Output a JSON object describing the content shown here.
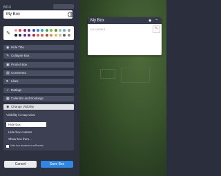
{
  "editor": {
    "section_label": "BOX",
    "name_value": "My Box",
    "menu": [
      {
        "label": "Hide Title",
        "icon": "eye-slash-icon",
        "glyph": "◉"
      },
      {
        "label": "Collapse Box",
        "icon": "wrench-icon",
        "glyph": "✎"
      },
      {
        "label": "Protect Box",
        "icon": "lock-icon",
        "glyph": "▣"
      },
      {
        "label": "Comments",
        "icon": "comment-icon",
        "glyph": "▤"
      },
      {
        "label": "Likes",
        "icon": "heart-icon",
        "glyph": "♥"
      },
      {
        "label": "Ratings",
        "icon": "thumbs-up-icon",
        "glyph": "✓"
      },
      {
        "label": "Calendar and Bookings",
        "icon": "calendar-icon",
        "glyph": "▦"
      },
      {
        "label": "Change Visibility",
        "icon": "eye-icon",
        "glyph": "◉"
      }
    ],
    "visibility": {
      "title": "Visibility in map view:",
      "options": [
        "Hide box",
        "Hide box content",
        "Show box from..."
      ],
      "selected_index": 0,
      "checkbox_label": "Hide box students in edit mode"
    },
    "cancel_label": "Cancel",
    "save_label": "Save Box"
  },
  "palette_colors": [
    "#f0a0b0",
    "#e04040",
    "#8a2a5a",
    "#5a3a8a",
    "#3a4aa0",
    "#3a80d0",
    "#40a0a0",
    "#40a060",
    "#80c040",
    "#6a8a30",
    "#a0c0a0",
    "#60b0e0",
    "#a0a0a0",
    "#202020",
    "#303050",
    "#6a2a8a",
    "#8a1a8a",
    "#a03030",
    "#e06060",
    "#c07040",
    "#a05030",
    "#e09050",
    "#e0c040",
    "#c0c0c0",
    "#606060",
    "#909090"
  ],
  "preview": {
    "title": "My Box",
    "content_placeholder": "no content"
  }
}
